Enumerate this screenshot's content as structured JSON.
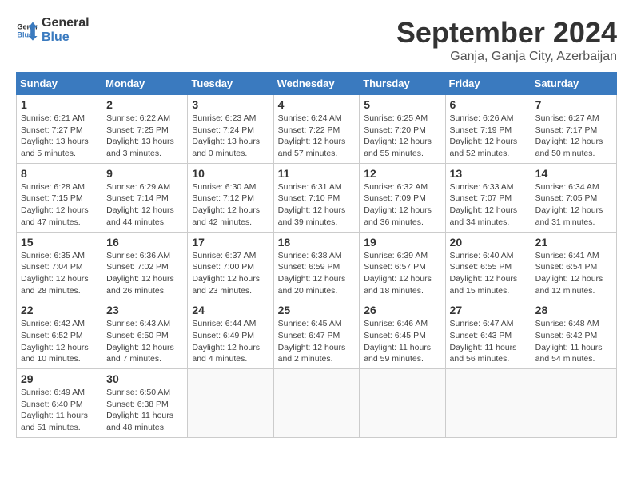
{
  "header": {
    "logo_general": "General",
    "logo_blue": "Blue",
    "month_title": "September 2024",
    "location": "Ganja, Ganja City, Azerbaijan"
  },
  "days_of_week": [
    "Sunday",
    "Monday",
    "Tuesday",
    "Wednesday",
    "Thursday",
    "Friday",
    "Saturday"
  ],
  "weeks": [
    [
      {
        "day": "1",
        "detail": "Sunrise: 6:21 AM\nSunset: 7:27 PM\nDaylight: 13 hours\nand 5 minutes."
      },
      {
        "day": "2",
        "detail": "Sunrise: 6:22 AM\nSunset: 7:25 PM\nDaylight: 13 hours\nand 3 minutes."
      },
      {
        "day": "3",
        "detail": "Sunrise: 6:23 AM\nSunset: 7:24 PM\nDaylight: 13 hours\nand 0 minutes."
      },
      {
        "day": "4",
        "detail": "Sunrise: 6:24 AM\nSunset: 7:22 PM\nDaylight: 12 hours\nand 57 minutes."
      },
      {
        "day": "5",
        "detail": "Sunrise: 6:25 AM\nSunset: 7:20 PM\nDaylight: 12 hours\nand 55 minutes."
      },
      {
        "day": "6",
        "detail": "Sunrise: 6:26 AM\nSunset: 7:19 PM\nDaylight: 12 hours\nand 52 minutes."
      },
      {
        "day": "7",
        "detail": "Sunrise: 6:27 AM\nSunset: 7:17 PM\nDaylight: 12 hours\nand 50 minutes."
      }
    ],
    [
      {
        "day": "8",
        "detail": "Sunrise: 6:28 AM\nSunset: 7:15 PM\nDaylight: 12 hours\nand 47 minutes."
      },
      {
        "day": "9",
        "detail": "Sunrise: 6:29 AM\nSunset: 7:14 PM\nDaylight: 12 hours\nand 44 minutes."
      },
      {
        "day": "10",
        "detail": "Sunrise: 6:30 AM\nSunset: 7:12 PM\nDaylight: 12 hours\nand 42 minutes."
      },
      {
        "day": "11",
        "detail": "Sunrise: 6:31 AM\nSunset: 7:10 PM\nDaylight: 12 hours\nand 39 minutes."
      },
      {
        "day": "12",
        "detail": "Sunrise: 6:32 AM\nSunset: 7:09 PM\nDaylight: 12 hours\nand 36 minutes."
      },
      {
        "day": "13",
        "detail": "Sunrise: 6:33 AM\nSunset: 7:07 PM\nDaylight: 12 hours\nand 34 minutes."
      },
      {
        "day": "14",
        "detail": "Sunrise: 6:34 AM\nSunset: 7:05 PM\nDaylight: 12 hours\nand 31 minutes."
      }
    ],
    [
      {
        "day": "15",
        "detail": "Sunrise: 6:35 AM\nSunset: 7:04 PM\nDaylight: 12 hours\nand 28 minutes."
      },
      {
        "day": "16",
        "detail": "Sunrise: 6:36 AM\nSunset: 7:02 PM\nDaylight: 12 hours\nand 26 minutes."
      },
      {
        "day": "17",
        "detail": "Sunrise: 6:37 AM\nSunset: 7:00 PM\nDaylight: 12 hours\nand 23 minutes."
      },
      {
        "day": "18",
        "detail": "Sunrise: 6:38 AM\nSunset: 6:59 PM\nDaylight: 12 hours\nand 20 minutes."
      },
      {
        "day": "19",
        "detail": "Sunrise: 6:39 AM\nSunset: 6:57 PM\nDaylight: 12 hours\nand 18 minutes."
      },
      {
        "day": "20",
        "detail": "Sunrise: 6:40 AM\nSunset: 6:55 PM\nDaylight: 12 hours\nand 15 minutes."
      },
      {
        "day": "21",
        "detail": "Sunrise: 6:41 AM\nSunset: 6:54 PM\nDaylight: 12 hours\nand 12 minutes."
      }
    ],
    [
      {
        "day": "22",
        "detail": "Sunrise: 6:42 AM\nSunset: 6:52 PM\nDaylight: 12 hours\nand 10 minutes."
      },
      {
        "day": "23",
        "detail": "Sunrise: 6:43 AM\nSunset: 6:50 PM\nDaylight: 12 hours\nand 7 minutes."
      },
      {
        "day": "24",
        "detail": "Sunrise: 6:44 AM\nSunset: 6:49 PM\nDaylight: 12 hours\nand 4 minutes."
      },
      {
        "day": "25",
        "detail": "Sunrise: 6:45 AM\nSunset: 6:47 PM\nDaylight: 12 hours\nand 2 minutes."
      },
      {
        "day": "26",
        "detail": "Sunrise: 6:46 AM\nSunset: 6:45 PM\nDaylight: 11 hours\nand 59 minutes."
      },
      {
        "day": "27",
        "detail": "Sunrise: 6:47 AM\nSunset: 6:43 PM\nDaylight: 11 hours\nand 56 minutes."
      },
      {
        "day": "28",
        "detail": "Sunrise: 6:48 AM\nSunset: 6:42 PM\nDaylight: 11 hours\nand 54 minutes."
      }
    ],
    [
      {
        "day": "29",
        "detail": "Sunrise: 6:49 AM\nSunset: 6:40 PM\nDaylight: 11 hours\nand 51 minutes."
      },
      {
        "day": "30",
        "detail": "Sunrise: 6:50 AM\nSunset: 6:38 PM\nDaylight: 11 hours\nand 48 minutes."
      },
      {
        "day": "",
        "detail": ""
      },
      {
        "day": "",
        "detail": ""
      },
      {
        "day": "",
        "detail": ""
      },
      {
        "day": "",
        "detail": ""
      },
      {
        "day": "",
        "detail": ""
      }
    ]
  ]
}
